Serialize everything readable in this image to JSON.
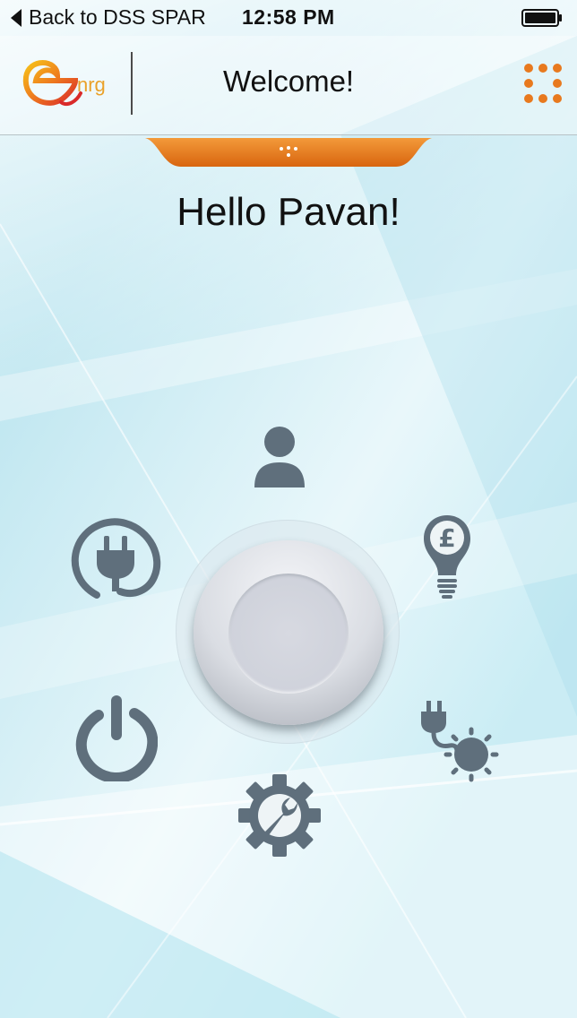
{
  "status_bar": {
    "back_label": "Back to DSS SPAR",
    "time": "12:58 PM"
  },
  "header": {
    "logo_text": "nrg",
    "title": "Welcome!"
  },
  "greeting": "Hello Pavan!",
  "menu_icons": [
    "user-icon",
    "plug-circle-icon",
    "pound-bulb-icon",
    "power-icon",
    "plug-sun-icon",
    "settings-gear-icon"
  ],
  "colors": {
    "accent_orange": "#e8791e",
    "icon_gray": "#5f6f7c"
  }
}
